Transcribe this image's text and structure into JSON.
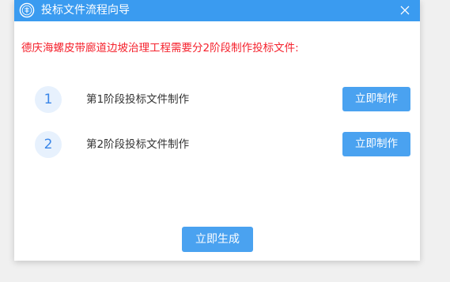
{
  "window": {
    "title": "投标文件流程向导",
    "logo_icon": "seal-logo-icon",
    "close_icon": "close-icon",
    "titlebar_color": "#3a9bf0"
  },
  "notice": {
    "text": "德庆海螺皮带廊道边坡治理工程需要分2阶段制作投标文件:",
    "color": "#f5222d"
  },
  "steps": [
    {
      "number": "1",
      "label": "第1阶段投标文件制作",
      "button_label": "立即制作"
    },
    {
      "number": "2",
      "label": "第2阶段投标文件制作",
      "button_label": "立即制作"
    }
  ],
  "footer": {
    "generate_label": "立即生成",
    "button_color": "#4aa2f0"
  }
}
